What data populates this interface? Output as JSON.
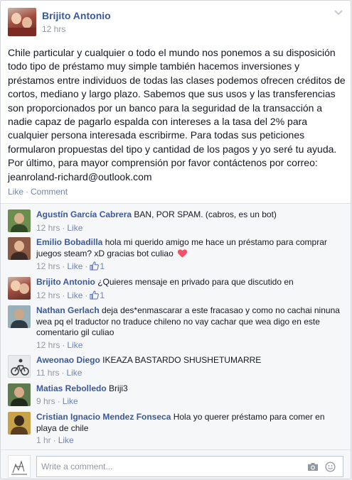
{
  "post": {
    "author": "Brijito Antonio",
    "time": "12 hrs",
    "body": "Chile particular y cualquier o todo el mundo nos ponemos a su disposición todo tipo de préstamo muy simple también hacemos inversiones y préstamos entre individuos de todas las clases podemos ofrecen créditos de cortos, mediano y largo plazo. Sabemos que sus usos y las transferencias son proporcionados por un banco para la seguridad de la transacción a nadie capaz de pagarlo espalda con intereses a la tasa del 2% para cualquier persona interesada escribirme. Para todas sus peticiones formularon propuestas del tipo y cantidad de los pagos y yo seré tu ayuda. Por último, para mayor comprensión por favor contáctenos por correo: jeanroland-richard@outlook.com",
    "like_label": "Like",
    "comment_label": "Comment",
    "separator": "·"
  },
  "comments": [
    {
      "author": "Agustín García Cabrera",
      "text": "BAN, POR SPAM. (cabros, es un bot)",
      "time": "12 hrs",
      "like_label": "Like",
      "likes": ""
    },
    {
      "author": "Emilio Bobadilla",
      "text": "hola mi querido amigo me hace un préstamo para comprar juegos steam? xD gracias bot culiao",
      "time": "12 hrs",
      "like_label": "Like",
      "likes": "1"
    },
    {
      "author": "Brijito Antonio",
      "text": "¿Quieres mensaje en privado para que discutido en",
      "time": "12 hrs",
      "like_label": "Like",
      "likes": "1"
    },
    {
      "author": "Nathan Gerlach",
      "text": "deja des*enmascarar a este fracasao y como no cachai ninuna wea pq el traductor no traduce chileno no vay cachar que wea digo en este comentario gil culiao",
      "time": "12 hrs",
      "like_label": "Like",
      "likes": ""
    },
    {
      "author": "Aweonao Diego",
      "text": "IKEAZA BASTARDO SHUSHETUMARRE",
      "time": "11 hrs",
      "like_label": "Like",
      "likes": ""
    },
    {
      "author": "Matias Rebolledo",
      "text": "Briji3",
      "time": "9 hrs",
      "like_label": "Like",
      "likes": ""
    },
    {
      "author": "Cristian Ignacio Mendez Fonseca",
      "text": "Hola yo querer préstamo para comer en playa de chile",
      "time": "1 hr",
      "like_label": "Like",
      "likes": ""
    }
  ],
  "composer": {
    "placeholder": "Write a comment..."
  },
  "icons": {
    "menu": "chevron-down-icon",
    "like": "thumbs-up-icon",
    "reaction": "heart-icon",
    "photo": "camera-icon",
    "emoji": "smiley-icon"
  },
  "colors": {
    "link": "#3b5998",
    "muted": "#9197a3",
    "action": "#6d84b4",
    "heart": "#f25268",
    "comments_bg": "#f6f7f9"
  }
}
